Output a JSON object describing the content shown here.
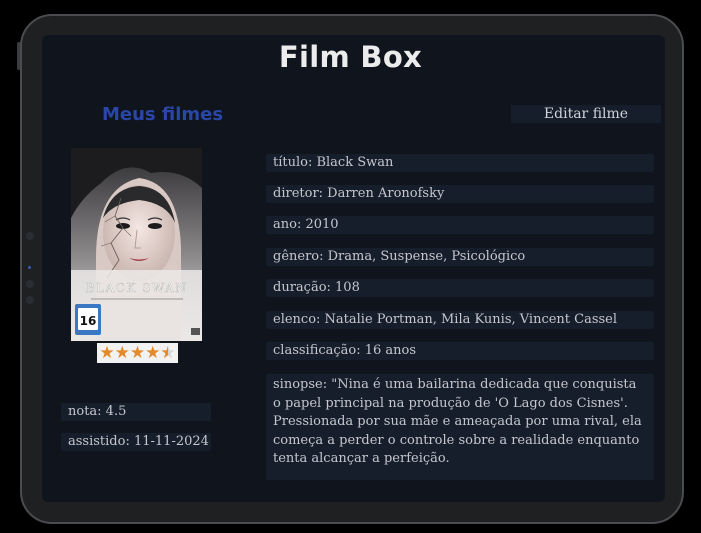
{
  "app": {
    "title": "Film Box"
  },
  "sidebar": {
    "heading": "Meus filmes"
  },
  "toolbar": {
    "edit_label": "Editar filme"
  },
  "poster": {
    "title_text": "BLACK SWAN",
    "age_rating": "16",
    "rating_stars": 4.5,
    "star_color": "#e58a2a"
  },
  "stats": {
    "nota": "nota: 4.5",
    "assistido": "assistido: 11-11-2024"
  },
  "details": {
    "titulo": "título: Black Swan",
    "diretor": "diretor: Darren Aronofsky",
    "ano": "ano: 2010",
    "genero": "gênero: Drama, Suspense, Psicológico",
    "duracao": "duração: 108",
    "elenco": "elenco: Natalie Portman, Mila Kunis, Vincent Cassel",
    "classificacao": "classificação: 16 anos",
    "sinopse": "sinopse: \"Nina é uma bailarina dedicada que conquista o papel principal na produção de 'O Lago dos Cisnes'. Pressionada por sua mãe e ameaçada por uma rival, ela começa a perder o controle sobre a realidade enquanto tenta alcançar a perfeição."
  },
  "colors": {
    "background": "#0f141d",
    "field_bg": "#171e2b",
    "accent": "#2a46a6",
    "title": "#ececec"
  }
}
